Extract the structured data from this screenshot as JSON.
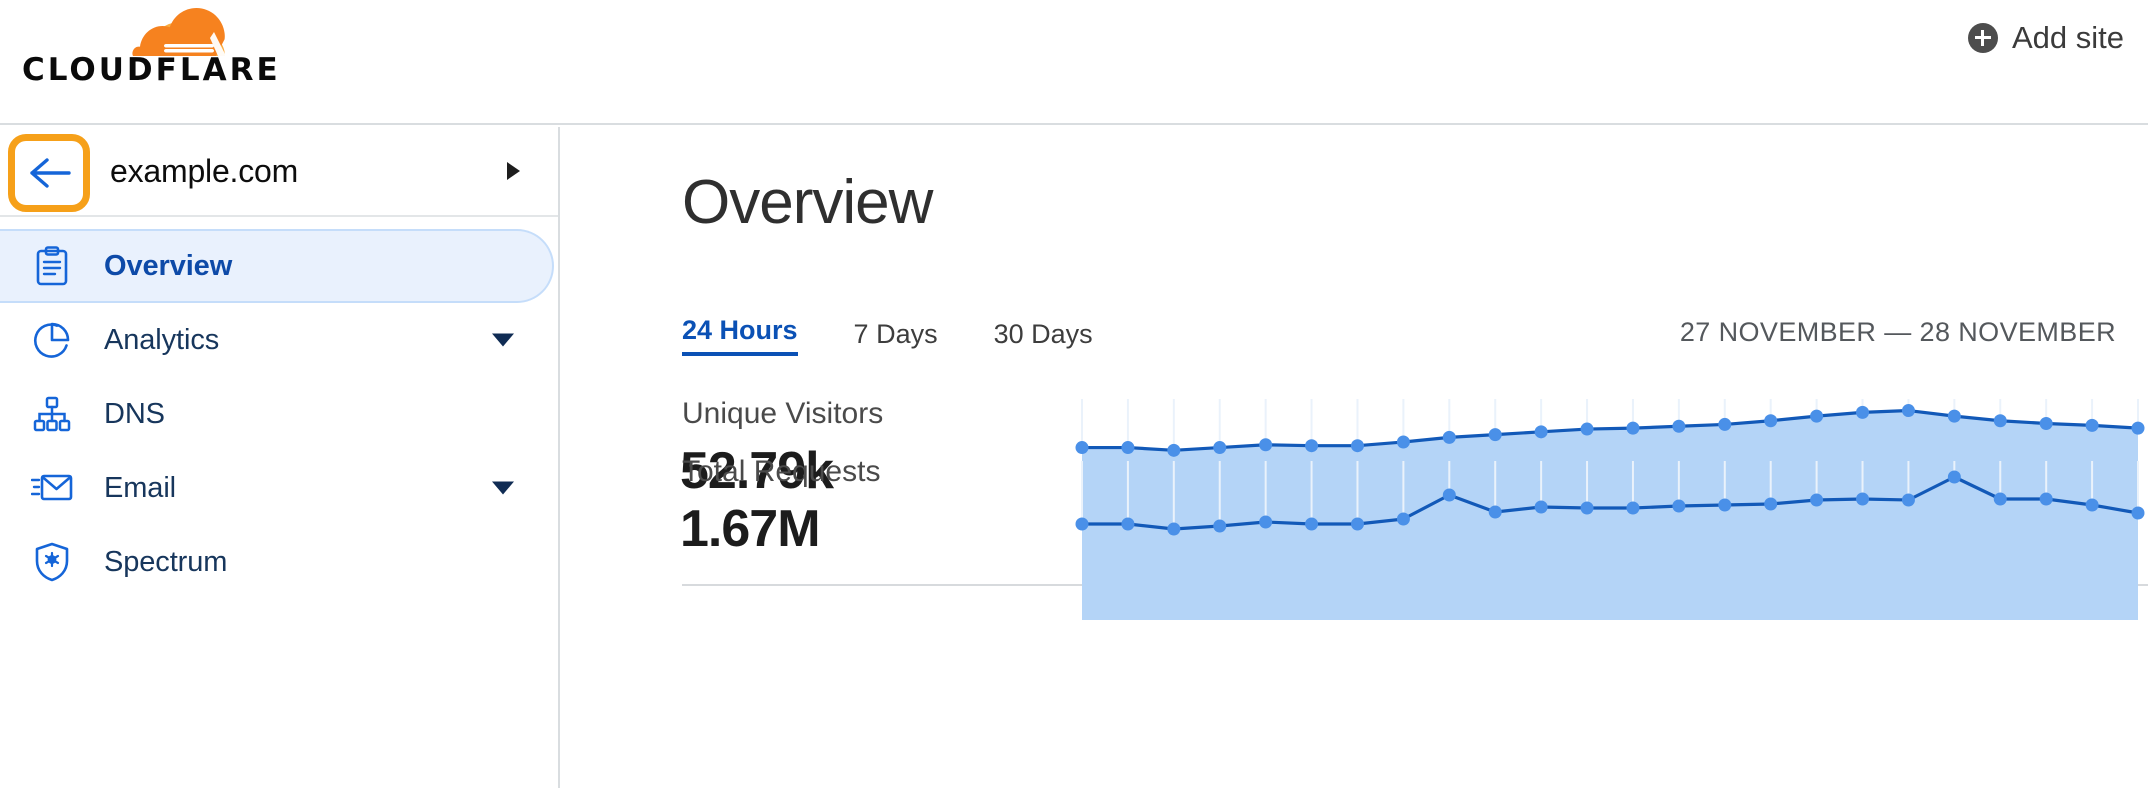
{
  "brand": {
    "name": "CLOUDFLARE",
    "logo_icon": "cloudflare-cloud-icon",
    "cloud_color_dark": "#f6821f",
    "cloud_color_light": "#fbad41"
  },
  "topbar": {
    "add_site_label": "Add site",
    "add_site_icon": "plus-circle-icon"
  },
  "sidebar": {
    "site_selector": {
      "back_icon": "arrow-left-icon",
      "site_name": "example.com",
      "caret_icon": "caret-right-icon",
      "highlight_color": "#f6a019"
    },
    "items": [
      {
        "label": "Overview",
        "icon": "clipboard-icon",
        "active": true,
        "has_caret": false
      },
      {
        "label": "Analytics",
        "icon": "pie-chart-icon",
        "active": false,
        "has_caret": true
      },
      {
        "label": "DNS",
        "icon": "hierarchy-icon",
        "active": false,
        "has_caret": false
      },
      {
        "label": "Email",
        "icon": "envelope-icon",
        "active": false,
        "has_caret": true
      },
      {
        "label": "Spectrum",
        "icon": "shield-star-icon",
        "active": false,
        "has_caret": false
      }
    ]
  },
  "main": {
    "title": "Overview",
    "tabs": [
      {
        "label": "24 Hours",
        "active": true
      },
      {
        "label": "7 Days",
        "active": false
      },
      {
        "label": "30 Days",
        "active": false
      }
    ],
    "date_range": "27 NOVEMBER — 28 NOVEMBER",
    "metrics": [
      {
        "label": "Unique Visitors",
        "value": "52.79k"
      },
      {
        "label": "Total Requests",
        "value": "1.67M"
      }
    ]
  },
  "colors": {
    "accent_blue": "#0b51b5",
    "line_blue": "#1259b8",
    "dot_blue": "#4a90e8",
    "area_blue": "#b4d4f7",
    "gridline": "#eaf2fb",
    "active_nav_bg": "#e9f1fd",
    "nav_text": "#17365c"
  },
  "chart_data": [
    {
      "type": "area",
      "title": "Unique Visitors",
      "total": "52.79k",
      "xlabel": "",
      "ylabel": "",
      "grid": true,
      "legend": "none",
      "x": [
        0,
        1,
        2,
        3,
        4,
        5,
        6,
        7,
        8,
        9,
        10,
        11,
        12,
        13,
        14,
        15,
        16,
        17,
        18,
        19,
        20,
        21,
        22,
        23
      ],
      "values": [
        34,
        34,
        31,
        34,
        37,
        36,
        36,
        40,
        45,
        48,
        51,
        54,
        55,
        57,
        59,
        63,
        68,
        72,
        74,
        68,
        63,
        60,
        58,
        55
      ],
      "ylim": [
        0,
        80
      ]
    },
    {
      "type": "area",
      "title": "Total Requests",
      "total": "1.67M",
      "xlabel": "",
      "ylabel": "",
      "grid": true,
      "legend": "none",
      "x": [
        0,
        1,
        2,
        3,
        4,
        5,
        6,
        7,
        8,
        9,
        10,
        11,
        12,
        13,
        14,
        15,
        16,
        17,
        18,
        19,
        20,
        21,
        22,
        23
      ],
      "values": [
        33,
        33,
        28,
        31,
        35,
        33,
        33,
        38,
        62,
        45,
        50,
        49,
        49,
        51,
        52,
        53,
        57,
        58,
        57,
        80,
        58,
        58,
        52,
        44
      ],
      "ylim": [
        0,
        90
      ]
    }
  ]
}
